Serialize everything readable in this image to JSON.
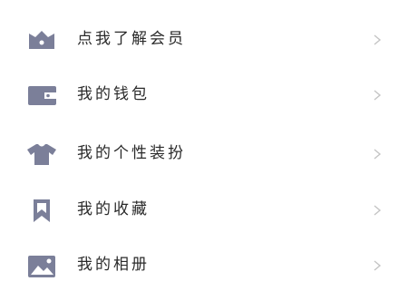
{
  "menu": {
    "icon_color": "#7b7f99",
    "chevron_color": "#c4c4c4",
    "items": [
      {
        "label": "点我了解会员",
        "icon": "crown-icon"
      },
      {
        "label": "我的钱包",
        "icon": "wallet-icon"
      },
      {
        "label": "我的个性装扮",
        "icon": "tshirt-icon"
      },
      {
        "label": "我的收藏",
        "icon": "bookmark-icon"
      },
      {
        "label": "我的相册",
        "icon": "photo-album-icon"
      }
    ]
  }
}
